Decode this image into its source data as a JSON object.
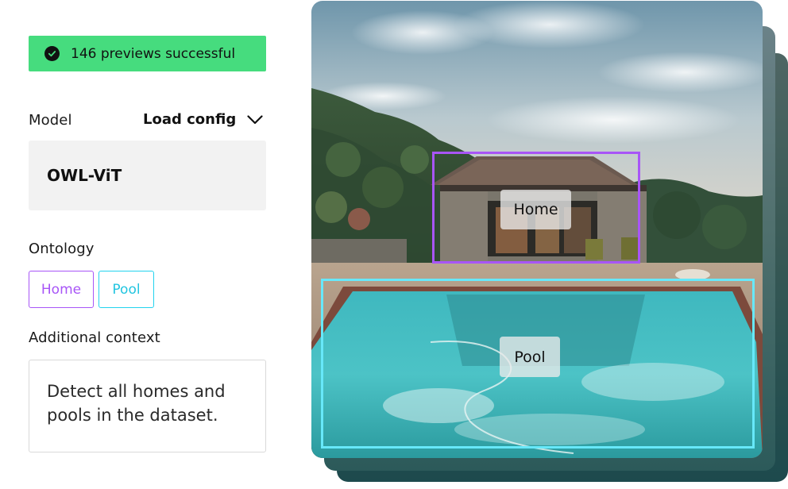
{
  "status": {
    "message": "146 previews successful",
    "icon": "check-circle-icon",
    "color": "#46dc7e"
  },
  "model": {
    "label": "Model",
    "load_config_label": "Load config",
    "load_config_icon": "chevron-down-icon",
    "value": "OWL-ViT"
  },
  "ontology": {
    "label": "Ontology",
    "classes": [
      {
        "name": "Home",
        "color": "#a855f7"
      },
      {
        "name": "Pool",
        "color": "#22d3ee"
      }
    ]
  },
  "context": {
    "label": "Additional context",
    "value": "Detect all homes and pools in the dataset."
  },
  "preview": {
    "detections": [
      {
        "label": "Home",
        "color": "#a855f7"
      },
      {
        "label": "Pool",
        "color": "#67e8f9"
      }
    ]
  }
}
